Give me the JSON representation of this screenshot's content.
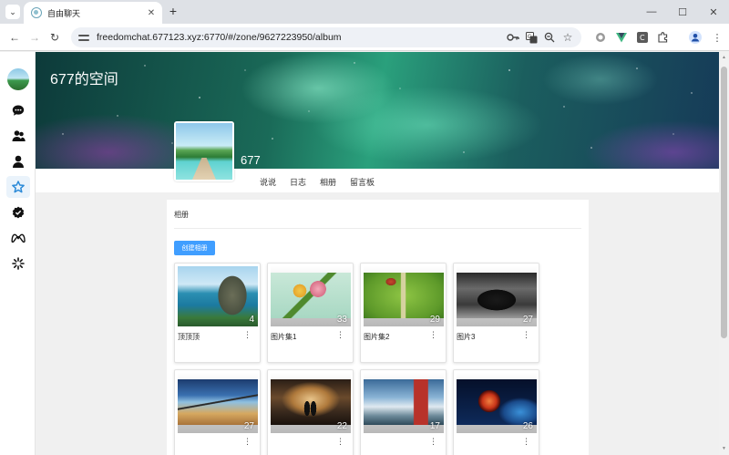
{
  "browser": {
    "tab_title": "自由聊天",
    "tab_close": "✕",
    "new_tab": "+",
    "url": "freedomchat.677123.xyz:6770/#/zone/9627223950/album"
  },
  "zone": {
    "banner_title": "677的空间",
    "user_name": "677",
    "tabs": [
      "说说",
      "日志",
      "相册",
      "留言板"
    ]
  },
  "album_section": {
    "title": "相册",
    "create_button": "创建相册"
  },
  "albums": [
    {
      "name": "顶顶顶",
      "count": "4",
      "theme": "coast"
    },
    {
      "name": "图片集1",
      "count": "33",
      "theme": "flower"
    },
    {
      "name": "图片集2",
      "count": "29",
      "theme": "bird"
    },
    {
      "name": "图片3",
      "count": "27",
      "theme": "car"
    },
    {
      "name": "",
      "count": "27",
      "theme": "pier"
    },
    {
      "name": "",
      "count": "22",
      "theme": "road"
    },
    {
      "name": "",
      "count": "17",
      "theme": "pagoda"
    },
    {
      "name": "",
      "count": "26",
      "theme": "planet"
    }
  ],
  "colors": {
    "primary_button": "#409eff",
    "active_nav": "#2b8ad8"
  }
}
